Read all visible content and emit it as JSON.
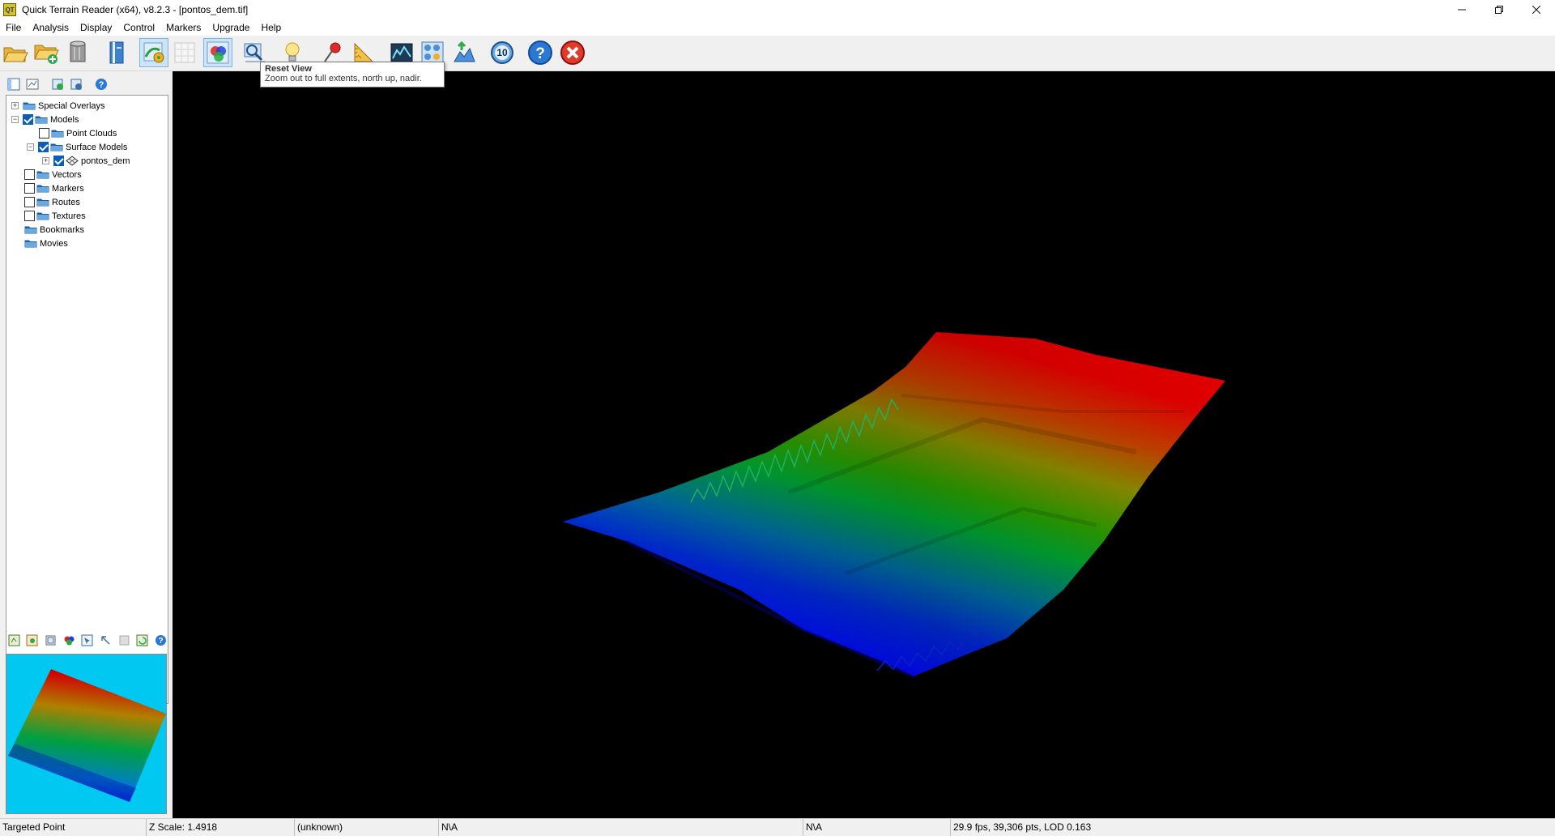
{
  "window": {
    "app_icon_text": "QT",
    "title": "Quick Terrain Reader (x64), v8.2.3 - [pontos_dem.tif]",
    "controls": [
      "minimize",
      "restore",
      "close"
    ]
  },
  "menu": {
    "items": [
      "File",
      "Analysis",
      "Display",
      "Control",
      "Markers",
      "Upgrade",
      "Help"
    ]
  },
  "toolbar": {
    "buttons": [
      {
        "name": "open-folder-icon"
      },
      {
        "name": "add-folder-icon"
      },
      {
        "name": "database-icon"
      },
      {
        "name": "book-icon"
      },
      {
        "name": "layer-color-icon",
        "state": "active"
      },
      {
        "name": "grid-disabled-icon",
        "state": "disabled"
      },
      {
        "name": "rgb-icon",
        "state": "active"
      },
      {
        "name": "reset-view-icon"
      },
      {
        "name": "lightbulb-icon"
      },
      {
        "name": "marker-pin-icon"
      },
      {
        "name": "ruler-icon"
      },
      {
        "name": "profile-icon"
      },
      {
        "name": "grid-circles-icon"
      },
      {
        "name": "sun-shade-icon"
      },
      {
        "name": "counter-icon",
        "label": "10"
      },
      {
        "name": "help-icon"
      },
      {
        "name": "exit-icon"
      }
    ],
    "tooltip": {
      "title": "Reset View",
      "body": "Zoom out to full extents, north up, nadir."
    }
  },
  "tree": {
    "nodes": [
      {
        "label": "Special Overlays",
        "level": 0,
        "expander": "+",
        "checkbox": "none"
      },
      {
        "label": "Models",
        "level": 0,
        "expander": "-",
        "checkbox": "on"
      },
      {
        "label": "Point Clouds",
        "level": 1,
        "expander": "none",
        "checkbox": "off"
      },
      {
        "label": "Surface Models",
        "level": 1,
        "expander": "-",
        "checkbox": "on"
      },
      {
        "label": "pontos_dem",
        "level": 2,
        "expander": "+",
        "checkbox": "on",
        "icon": "surface"
      },
      {
        "label": "Vectors",
        "level": 0,
        "expander": "none",
        "checkbox": "off"
      },
      {
        "label": "Markers",
        "level": 0,
        "expander": "none",
        "checkbox": "off"
      },
      {
        "label": "Routes",
        "level": 0,
        "expander": "none",
        "checkbox": "off"
      },
      {
        "label": "Textures",
        "level": 0,
        "expander": "none",
        "checkbox": "off"
      },
      {
        "label": "Bookmarks",
        "level": 0,
        "expander": "none",
        "checkbox": "none"
      },
      {
        "label": "Movies",
        "level": 0,
        "expander": "none",
        "checkbox": "none"
      }
    ]
  },
  "status": {
    "targeted_point": "Targeted Point",
    "z_scale": "Z Scale: 1.4918",
    "unknown": "(unknown)",
    "coord_a": "N\\A",
    "coord_b": "N\\A",
    "performance": "29.9 fps, 39,306 pts, LOD 0.163"
  },
  "colors": {
    "viewport_bg": "#000000",
    "overview_bg": "#00c8f0",
    "tooltip_border": "#767676",
    "checkbox_on": "#0a5fb4",
    "ramp_low": "#0000ff",
    "ramp_mid": "#00b000",
    "ramp_high": "#e00000"
  }
}
